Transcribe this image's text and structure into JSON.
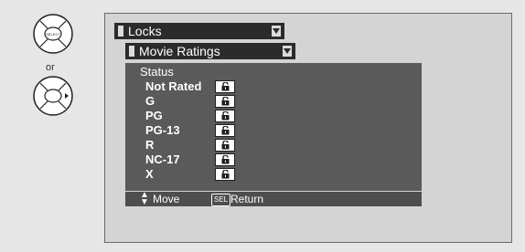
{
  "remote": {
    "select_button_label": "SELECT",
    "or_label": "or"
  },
  "screen": {
    "locks_menu": {
      "label": "Locks"
    },
    "ratings_menu": {
      "label": "Movie Ratings"
    },
    "status_title": "Status",
    "ratings": [
      {
        "label": "Not Rated",
        "state": "unlocked",
        "icon": "unlocked-padlock-icon"
      },
      {
        "label": "G",
        "state": "unlocked",
        "icon": "unlocked-padlock-icon"
      },
      {
        "label": "PG",
        "state": "unlocked",
        "icon": "unlocked-padlock-icon"
      },
      {
        "label": "PG-13",
        "state": "unlocked",
        "icon": "unlocked-padlock-icon"
      },
      {
        "label": "R",
        "state": "unlocked",
        "icon": "unlocked-padlock-icon"
      },
      {
        "label": "NC-17",
        "state": "unlocked",
        "icon": "unlocked-padlock-icon"
      },
      {
        "label": "X",
        "state": "unlocked",
        "icon": "unlocked-padlock-icon"
      }
    ],
    "footer": {
      "move_label": "Move",
      "sel_key": "SEL",
      "return_label": "Return"
    }
  },
  "colors": {
    "menu_bar": "#2b2b2b",
    "panel": "#5a5a5a",
    "footer": "#4e4e4e",
    "screen": "#d4d4d4"
  }
}
